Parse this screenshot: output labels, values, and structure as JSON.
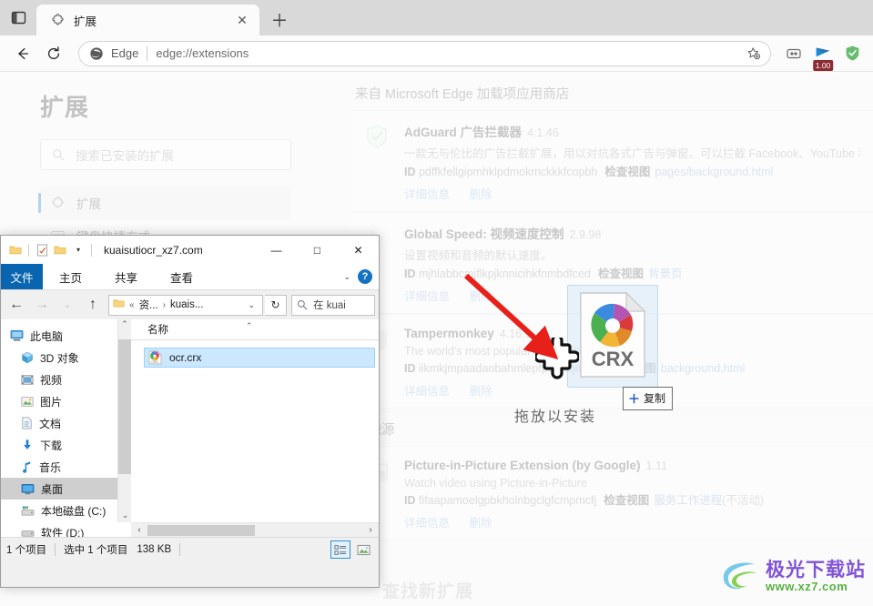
{
  "browser": {
    "tab_actions_icon": "split-pane-icon",
    "tab": {
      "title": "扩展",
      "favicon": "puzzle-piece-icon",
      "close_label": "✕"
    },
    "newtab_label": "＋",
    "back_label": "←",
    "reload_label": "⟳",
    "omnibox": {
      "brand": "Edge",
      "url": "edge://extensions",
      "brand_icon": "edge-logo-icon",
      "favorite_icon": "star-plus-icon"
    },
    "toolbar_icons": [
      {
        "name": "collections-icon",
        "label": ""
      },
      {
        "name": "global-speed-icon",
        "label": "",
        "badge": "1.00"
      },
      {
        "name": "adguard-shield-icon",
        "label": ""
      }
    ]
  },
  "extensions_page": {
    "sidebar": {
      "title": "扩展",
      "search_placeholder": "搜索已安装的扩展",
      "items": [
        {
          "label": "扩展",
          "icon": "puzzle-piece-icon",
          "active": true
        },
        {
          "label": "键盘快捷方式",
          "icon": "keyboard-icon",
          "active": false
        }
      ]
    },
    "sections": [
      {
        "title": "来自 Microsoft Edge 加载项应用商店"
      },
      {
        "title": "其他源"
      }
    ],
    "extensions": [
      {
        "name": "AdGuard 广告拦截器",
        "version": "4.1.46",
        "description": "一款无与伦比的广告拦截扩展，用以对抗各式广告与弹窗。可以拦截 Facebook、YouTube 和其它所…",
        "id_label": "ID",
        "id": "pdffkfellgipmhklpdmokmckkkfcopbh",
        "inspect_label": "检查视图",
        "inspect_target": "pages/background.html",
        "inspect_note": "",
        "links": [
          "详细信息",
          "删除"
        ],
        "icon": "adguard-shield-icon"
      },
      {
        "name": "Global Speed: 视频速度控制",
        "version": "2.9.98",
        "description": "设置视频和音频的默认速度。",
        "id_label": "ID",
        "id": "mjhlabbcmjflkpjknnicihkfnmbdfced",
        "inspect_label": "检查视图",
        "inspect_target": "背景页",
        "inspect_note": "",
        "links": [
          "详细信息",
          "删除"
        ],
        "icon": "play-triangle-icon"
      },
      {
        "name": "Tampermonkey",
        "version": "4.16.1",
        "description": "The world's most popular userscript manager",
        "id_label": "ID",
        "id": "iikmkjmpaadaobahmlepfpoenlfjmepa",
        "inspect_label": "检查视图",
        "inspect_target": "background.html",
        "inspect_note": "",
        "links": [
          "详细信息",
          "删除"
        ],
        "icon": "tampermonkey-icon"
      },
      {
        "name": "Picture-in-Picture Extension (by Google)",
        "version": "1.11",
        "description": "Watch video using Picture-in-Picture",
        "id_label": "ID",
        "id": "fifaapamoelgpbkholnbgclgfcmpmcfj",
        "inspect_label": "检查视图",
        "inspect_target": "服务工作进程",
        "inspect_note": "(不活动)",
        "links": [
          "详细信息",
          "删除"
        ],
        "icon": "pip-icon"
      }
    ],
    "dropzone_text": "拖放以安装",
    "find_more_text": "查找新扩展"
  },
  "drag": {
    "file_label": "CRX",
    "copy_tooltip": "复制",
    "copy_plus": "＋",
    "cursor_icon": "puzzle-piece-cursor-icon"
  },
  "explorer": {
    "title": "kuaisutiocr_xz7.com",
    "quick_access_icons": [
      "folder-icon",
      "properties-icon",
      "new-folder-icon",
      "customize-chevron-icon"
    ],
    "window_buttons": {
      "minimize": "—",
      "maximize": "□",
      "close": "✕"
    },
    "ribbon": {
      "file_tab": "文件",
      "tabs": [
        "主页",
        "共享",
        "查看"
      ],
      "collapse_icon": "chevron-down-icon",
      "help_label": "?"
    },
    "navbar": {
      "back": "←",
      "forward": "→",
      "recent": "⌄",
      "up": "↑",
      "breadcrumb": {
        "folder_icon": "folder-icon",
        "parts": [
          "«",
          "资...",
          "›",
          "kuais..."
        ],
        "caret": "⌄"
      },
      "refresh": "↻",
      "search_placeholder": "在 kuai",
      "search_icon": "search-icon"
    },
    "tree": [
      {
        "label": "此电脑",
        "icon": "this-pc-icon",
        "level": 0,
        "selected": false
      },
      {
        "label": "3D 对象",
        "icon": "3d-objects-icon",
        "level": 1,
        "selected": false
      },
      {
        "label": "视频",
        "icon": "videos-icon",
        "level": 1,
        "selected": false
      },
      {
        "label": "图片",
        "icon": "pictures-icon",
        "level": 1,
        "selected": false
      },
      {
        "label": "文档",
        "icon": "documents-icon",
        "level": 1,
        "selected": false
      },
      {
        "label": "下载",
        "icon": "downloads-icon",
        "level": 1,
        "selected": false
      },
      {
        "label": "音乐",
        "icon": "music-icon",
        "level": 1,
        "selected": false
      },
      {
        "label": "桌面",
        "icon": "desktop-icon",
        "level": 1,
        "selected": true
      },
      {
        "label": "本地磁盘 (C:)",
        "icon": "local-disk-icon",
        "level": 1,
        "selected": false
      },
      {
        "label": "软件 (D:)",
        "icon": "disk-icon",
        "level": 1,
        "selected": false
      }
    ],
    "column_header": "名称",
    "files": [
      {
        "name": "ocr.crx",
        "icon": "crx-file-icon",
        "selected": true
      }
    ],
    "status": {
      "item_count": "1 个项目",
      "selection": "选中 1 个项目",
      "size": "138 KB",
      "view_buttons": [
        {
          "name": "details-view-button",
          "active": true
        },
        {
          "name": "large-icons-view-button",
          "active": false
        }
      ]
    }
  },
  "watermark": {
    "cn": "极光下载站",
    "en": "www.xz7.com"
  }
}
